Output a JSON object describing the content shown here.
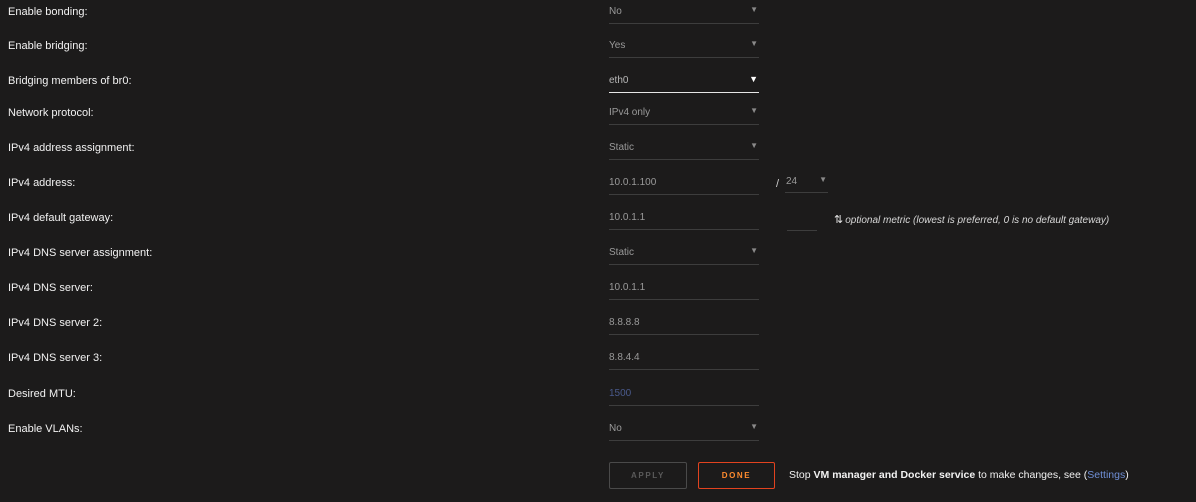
{
  "rows": {
    "bonding": {
      "label": "Enable bonding:",
      "value": "No"
    },
    "bridging": {
      "label": "Enable bridging:",
      "value": "Yes"
    },
    "bridge_members": {
      "label": "Bridging members of br0:",
      "value": "eth0"
    },
    "protocol": {
      "label": "Network protocol:",
      "value": "IPv4 only"
    },
    "ipv4_assign": {
      "label": "IPv4 address assignment:",
      "value": "Static"
    },
    "ipv4_address": {
      "label": "IPv4 address:",
      "value": "10.0.1.100",
      "slash": "/",
      "prefix": "24"
    },
    "gateway": {
      "label": "IPv4 default gateway:",
      "value": "10.0.1.1",
      "metric_value": "",
      "metric_note": "optional metric (lowest is preferred, 0 is no default gateway)"
    },
    "dns_assign": {
      "label": "IPv4 DNS server assignment:",
      "value": "Static"
    },
    "dns1": {
      "label": "IPv4 DNS server:",
      "value": "10.0.1.1"
    },
    "dns2": {
      "label": "IPv4 DNS server 2:",
      "value": "8.8.8.8"
    },
    "dns3": {
      "label": "IPv4 DNS server 3:",
      "value": "8.8.4.4"
    },
    "mtu": {
      "label": "Desired MTU:",
      "placeholder": "1500"
    },
    "vlans": {
      "label": "Enable VLANs:",
      "value": "No"
    }
  },
  "buttons": {
    "apply": "APPLY",
    "done": "DONE"
  },
  "footer": {
    "prefix": "Stop ",
    "bold": "VM manager and Docker service",
    "middle": " to make changes, see (",
    "link": "Settings",
    "suffix": ")"
  },
  "icons": {
    "dropdown": "triangle-down-icon",
    "sort": "sort-arrows-icon"
  },
  "colors": {
    "background": "#1c1b1b",
    "done_border": "#e2431f",
    "done_text": "#ff8c2f",
    "link": "#6f8fd6"
  }
}
